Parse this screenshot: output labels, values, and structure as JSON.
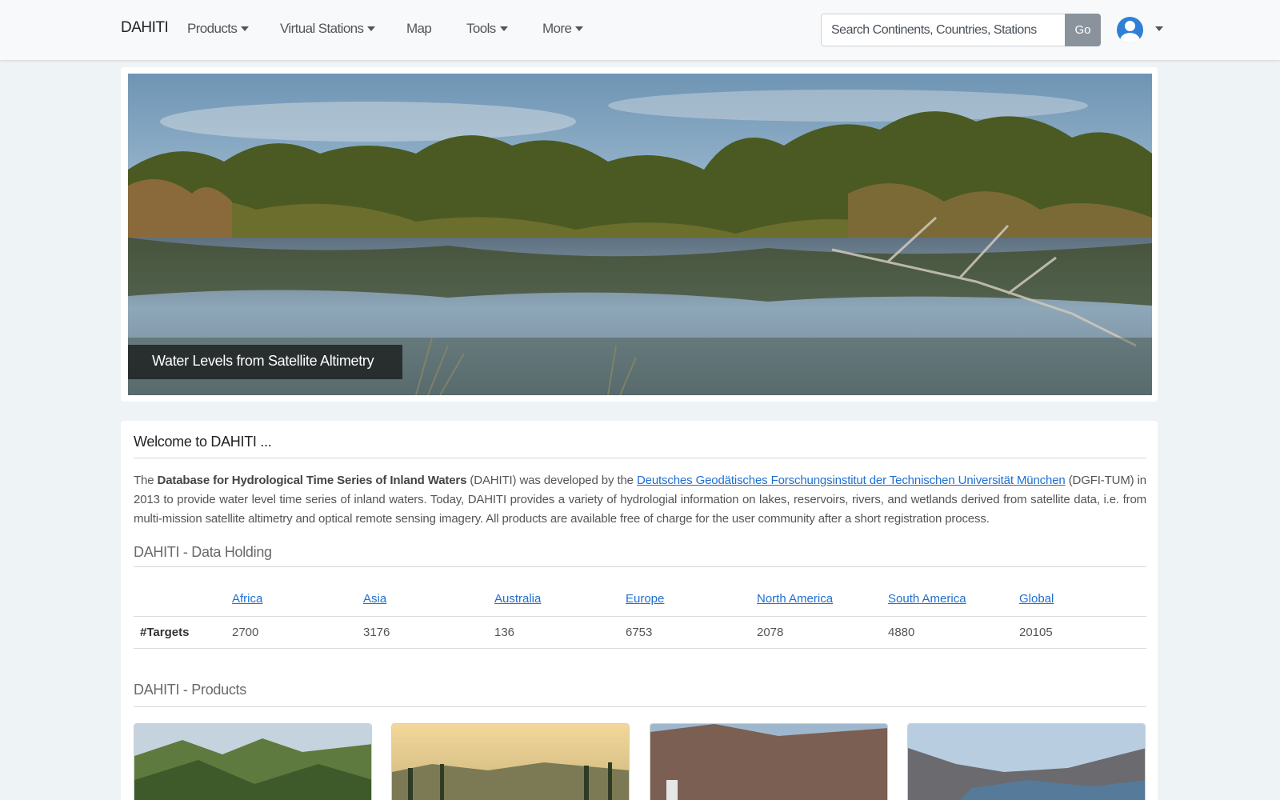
{
  "navbar": {
    "brand": "DAHITI",
    "items": [
      {
        "label": "Products",
        "dropdown": true
      },
      {
        "label": "Virtual Stations",
        "dropdown": true
      },
      {
        "label": "Map",
        "dropdown": false
      },
      {
        "label": "Tools",
        "dropdown": true
      },
      {
        "label": "More",
        "dropdown": true
      }
    ],
    "search_placeholder": "Search Continents, Countries, Stations",
    "go_label": "Go",
    "user_icon": "user-avatar-icon"
  },
  "hero": {
    "caption": "Water Levels from Satellite Altimetry"
  },
  "welcome": {
    "title": "Welcome to DAHITI ...",
    "intro_pre": "The ",
    "intro_bold": "Database for Hydrological Time Series of Inland Waters",
    "intro_mid": " (DAHITI) was developed by the ",
    "intro_link": "Deutsches Geodätisches Forschungsinstitut der Technischen Universität München",
    "intro_post": " (DGFI-TUM) in 2013 to provide water level time series of inland waters. Today, DAHITI provides a variety of hydrologial information on lakes, reservoirs, rivers, and wetlands derived from satellite data, i.e. from multi-mission satellite altimetry and optical remote sensing imagery. All products are available free of charge for the user community after a short registration process."
  },
  "data_holding": {
    "title": "DAHITI - Data Holding",
    "columns": [
      "Africa",
      "Asia",
      "Australia",
      "Europe",
      "North America",
      "South America",
      "Global"
    ],
    "row_label": "#Targets",
    "values": [
      "2700",
      "3176",
      "136",
      "6753",
      "2078",
      "4880",
      "20105"
    ]
  },
  "products": {
    "title": "DAHITI - Products"
  },
  "colors": {
    "link": "#1f6fd0",
    "go_button": "#8a939c",
    "avatar": "#2f7fd6",
    "page_bg": "#eef3f6"
  }
}
